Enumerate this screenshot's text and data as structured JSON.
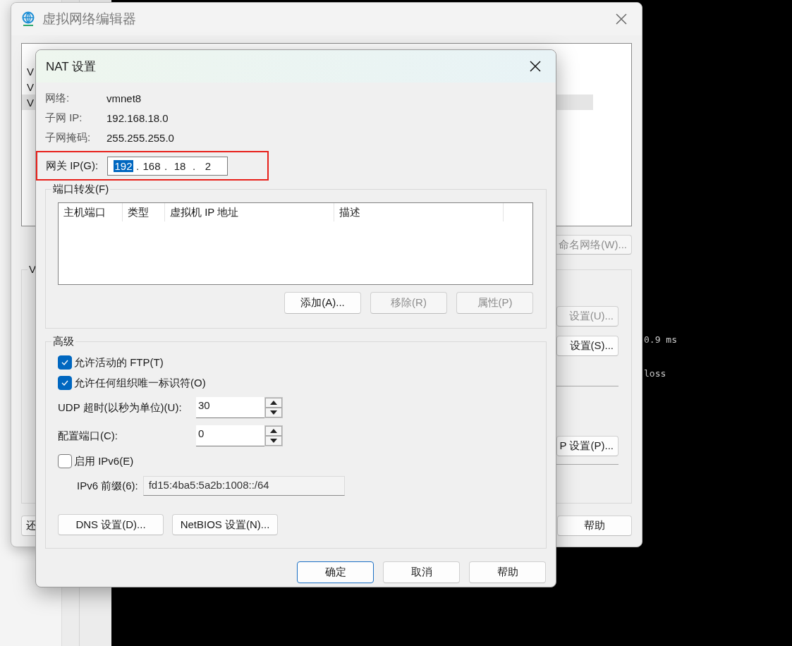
{
  "terminal": {
    "lines": [
      "0.9 ms",
      "loss"
    ]
  },
  "network_editor": {
    "title": "虚拟网络编辑器",
    "rows": [
      {
        "column_1": "V",
        "selected": false
      },
      {
        "column_1": "V",
        "selected": false
      },
      {
        "column_1": "V",
        "selected": true
      }
    ],
    "rename_button": {
      "label": "命名网络(W)...",
      "disabled": true
    },
    "group": {
      "title": "V",
      "buttons": [
        {
          "label": "设置(U)...",
          "disabled": true
        },
        {
          "label": "设置(S)...",
          "disabled": false
        },
        {
          "label": "P 设置(P)...",
          "disabled": false
        }
      ]
    },
    "footer_buttons": [
      {
        "label": "还"
      },
      {
        "label": "帮助"
      }
    ]
  },
  "nat_dialog": {
    "title": "NAT 设置",
    "info": [
      {
        "label": "网络:",
        "value": "vmnet8"
      },
      {
        "label": "子网 IP:",
        "value": "192.168.18.0"
      },
      {
        "label": "子网掩码:",
        "value": "255.255.255.0"
      }
    ],
    "gateway": {
      "label": "网关 IP(G):",
      "separator": ".",
      "highlighted": true,
      "octets": [
        {
          "value": "192",
          "selected": true
        },
        {
          "value": "168",
          "selected": false
        },
        {
          "value": "18",
          "selected": false
        },
        {
          "value": "2",
          "selected": false
        }
      ]
    },
    "port_forwarding": {
      "title": "端口转发(F)",
      "columns": [
        "主机端口",
        "类型",
        "虚拟机 IP 地址",
        "描述"
      ],
      "buttons": [
        {
          "label": "添加(A)...",
          "disabled": false
        },
        {
          "label": "移除(R)",
          "disabled": true
        },
        {
          "label": "属性(P)",
          "disabled": true
        }
      ]
    },
    "advanced": {
      "title": "高级",
      "checkboxes": [
        {
          "label": "允许活动的 FTP(T)",
          "checked": true
        },
        {
          "label": "允许任何组织唯一标识符(O)",
          "checked": true
        }
      ],
      "spinners": [
        {
          "label": "UDP 超时(以秒为单位)(U):",
          "value": "30"
        },
        {
          "label": "配置端口(C):",
          "value": "0"
        }
      ],
      "ipv6": {
        "label": "启用 IPv6(E)",
        "checked": false
      },
      "ipv6_prefix": {
        "label": "IPv6 前缀(6):",
        "value": "fd15:4ba5:5a2b:1008::/64"
      },
      "buttons": [
        {
          "label": "DNS 设置(D)..."
        },
        {
          "label": "NetBIOS 设置(N)..."
        }
      ]
    },
    "footer_buttons": [
      {
        "label": "确定",
        "default": true
      },
      {
        "label": "取消",
        "default": false
      },
      {
        "label": "帮助",
        "default": false
      }
    ]
  }
}
